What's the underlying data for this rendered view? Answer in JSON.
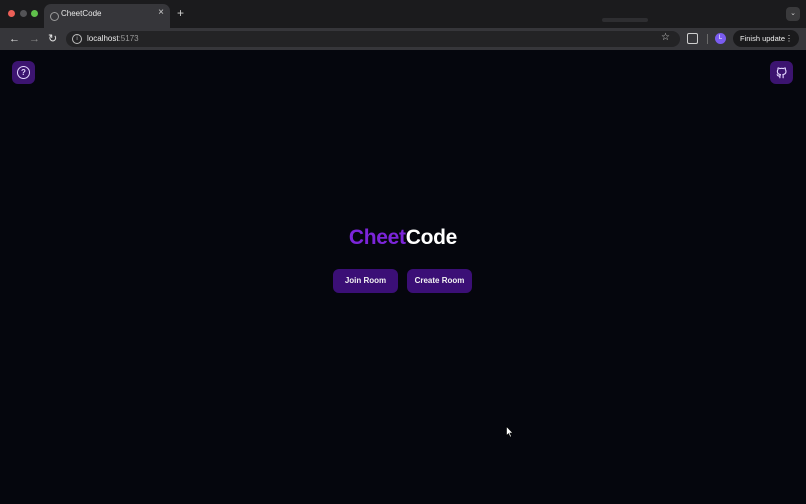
{
  "browser": {
    "tab_title": "CheetCode",
    "tab_close": "×",
    "new_tab": "+",
    "url_host": "localhost",
    "url_port": ":5173",
    "profile_initial": "L",
    "finish_update_label": "Finish update",
    "menu_dots": "⋮"
  },
  "page": {
    "brand_part1": "Cheet",
    "brand_part2": "Code",
    "help_symbol": "?",
    "join_room_label": "Join Room",
    "create_room_label": "Create Room"
  },
  "colors": {
    "background": "#05060d",
    "brand_accent": "#7c25d9",
    "button_bg": "#3b0f76",
    "icon_button_bg": "#3c1470"
  }
}
